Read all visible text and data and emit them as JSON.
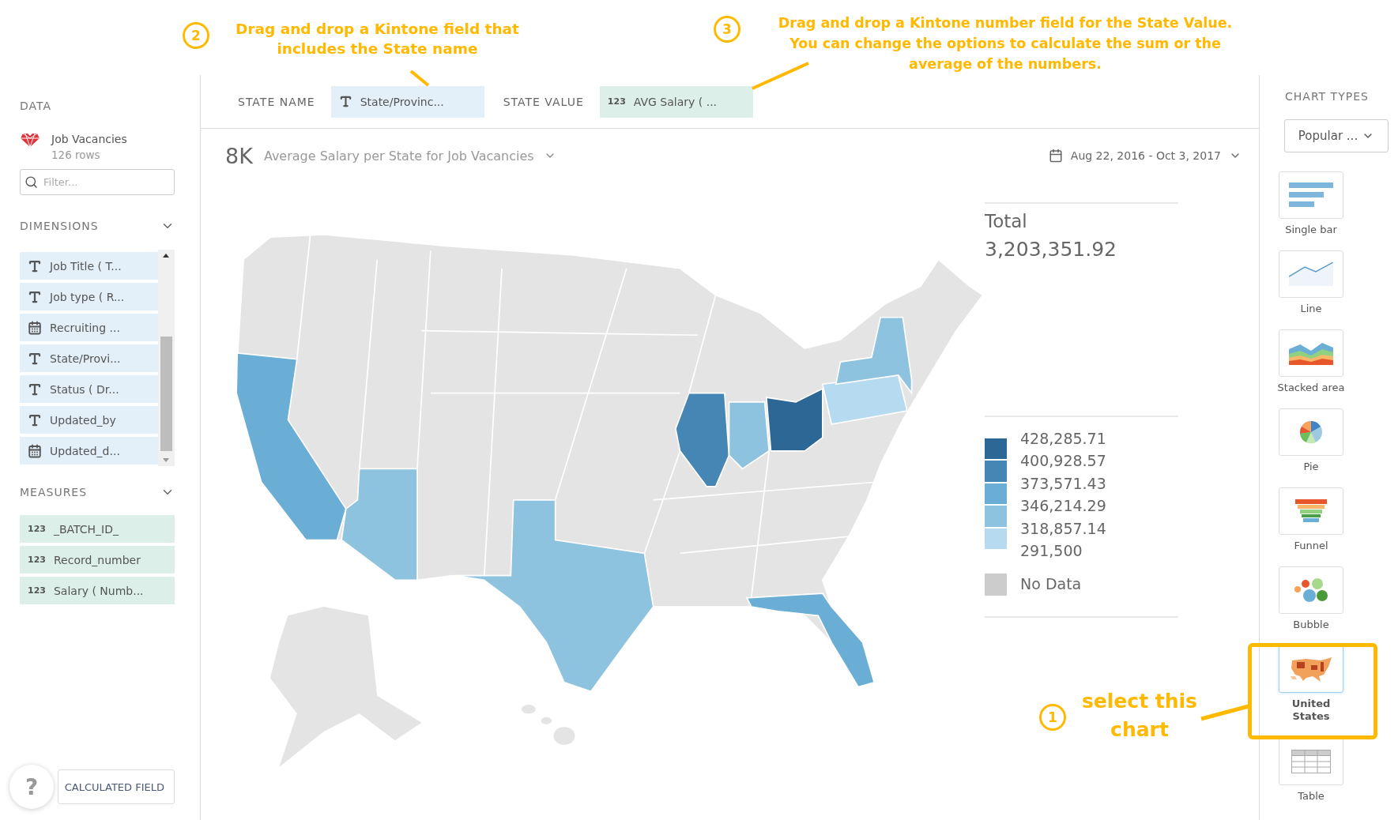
{
  "sidebar": {
    "heading": "DATA",
    "dataset": {
      "name": "Job Vacancies",
      "rows": "126 rows"
    },
    "filter": {
      "placeholder": "Filter..."
    },
    "dimensions": {
      "heading": "DIMENSIONS",
      "expanded": true,
      "items": [
        {
          "kind": "text",
          "label": "Job Title ( T..."
        },
        {
          "kind": "text",
          "label": "Job type ( R..."
        },
        {
          "kind": "date",
          "label": "Recruiting ..."
        },
        {
          "kind": "text",
          "label": "State/Provi..."
        },
        {
          "kind": "text",
          "label": "Status ( Dr..."
        },
        {
          "kind": "text",
          "label": "Updated_by"
        },
        {
          "kind": "date",
          "label": "Updated_d..."
        }
      ]
    },
    "measures": {
      "heading": "MEASURES",
      "expanded": true,
      "items": [
        {
          "type_label": "123",
          "label": "_BATCH_ID_"
        },
        {
          "type_label": "123",
          "label": "Record_number"
        },
        {
          "type_label": "123",
          "label": "Salary ( Numb..."
        }
      ]
    },
    "help": "?",
    "calculated_field_button": "CALCULATED FIELD"
  },
  "field_bar": {
    "state_name": {
      "label": "STATE NAME",
      "value": "State/Provinc..."
    },
    "state_value": {
      "label": "STATE VALUE",
      "type_label": "123",
      "value": "AVG Salary ( ..."
    }
  },
  "chart": {
    "size": "8K",
    "title": "Average Salary per State for Job Vacancies",
    "date_range": "Aug 22, 2016 - Oct 3, 2017"
  },
  "legend": {
    "total_label": "Total",
    "total_value": "3,203,351.92",
    "bands": [
      {
        "color": "#2c6795"
      },
      {
        "color": "#4686b4"
      },
      {
        "color": "#6aadd5"
      },
      {
        "color": "#8ec3e0"
      },
      {
        "color": "#b6dbf1"
      }
    ],
    "labels": [
      "428,285.71",
      "400,928.57",
      "373,571.43",
      "346,214.29",
      "318,857.14",
      "291,500"
    ],
    "no_data": {
      "label": "No Data",
      "color": "#cccccc"
    }
  },
  "chart_types": {
    "heading": "CHART TYPES",
    "filter": "Popular ...",
    "items": [
      {
        "kind": "single_bar",
        "label": "Single bar",
        "selected": false
      },
      {
        "kind": "line",
        "label": "Line",
        "selected": false
      },
      {
        "kind": "stacked_area",
        "label": "Stacked area",
        "selected": false
      },
      {
        "kind": "pie",
        "label": "Pie",
        "selected": false
      },
      {
        "kind": "funnel",
        "label": "Funnel",
        "selected": false
      },
      {
        "kind": "bubble",
        "label": "Bubble",
        "selected": false
      },
      {
        "kind": "us_map",
        "label": "United States",
        "selected": true
      },
      {
        "kind": "table",
        "label": "Table",
        "selected": false
      }
    ]
  },
  "annotations": [
    {
      "number": "2",
      "lines": [
        "Drag and drop a Kintone field that",
        "includes the State name"
      ]
    },
    {
      "number": "3",
      "lines": [
        "Drag and drop a Kintone number field for the State Value.",
        "You can change the options to calculate the sum or the",
        "average of the numbers."
      ]
    },
    {
      "number": "1",
      "lines": [
        "select this",
        "chart"
      ]
    }
  ]
}
